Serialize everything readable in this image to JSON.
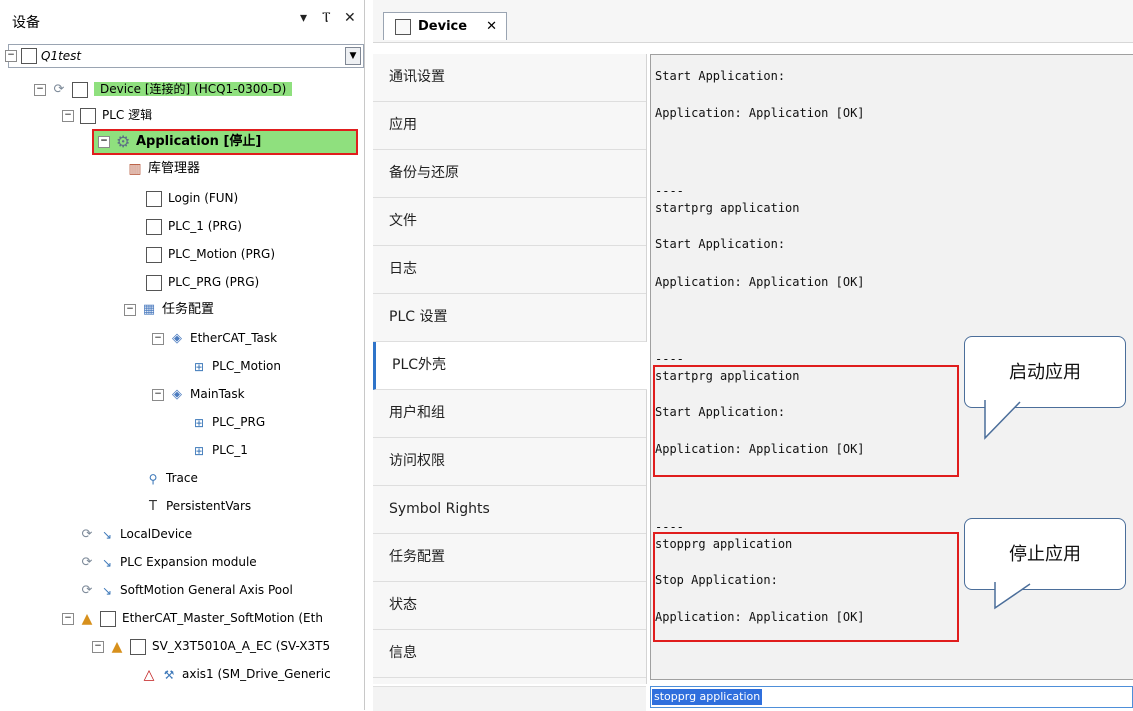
{
  "left_panel": {
    "title": "设备",
    "header_icons": [
      "▾",
      "Ⲧ",
      "✕"
    ],
    "root_project": "Q1test",
    "tree": [
      {
        "key": "device",
        "label": "Device [连接的] (HCQ1-0300-D)"
      },
      {
        "key": "plc_logic",
        "label": "PLC 逻辑"
      },
      {
        "key": "application",
        "label": "Application [停止]"
      },
      {
        "key": "library_manager",
        "label": "库管理器"
      },
      {
        "key": "login",
        "label": "Login (FUN)"
      },
      {
        "key": "plc1",
        "label": "PLC_1 (PRG)"
      },
      {
        "key": "plc_motion",
        "label": "PLC_Motion (PRG)"
      },
      {
        "key": "plc_prg",
        "label": "PLC_PRG (PRG)"
      },
      {
        "key": "task_config",
        "label": "任务配置"
      },
      {
        "key": "ethercat_task",
        "label": "EtherCAT_Task"
      },
      {
        "key": "ethercat_task_plc_motion",
        "label": "PLC_Motion"
      },
      {
        "key": "main_task",
        "label": "MainTask"
      },
      {
        "key": "main_task_plc_prg",
        "label": "PLC_PRG"
      },
      {
        "key": "main_task_plc1",
        "label": "PLC_1"
      },
      {
        "key": "trace",
        "label": "Trace"
      },
      {
        "key": "persistent_vars",
        "label": "PersistentVars"
      },
      {
        "key": "local_device",
        "label": "LocalDevice"
      },
      {
        "key": "plc_expansion",
        "label": "PLC Expansion module"
      },
      {
        "key": "softmotion_pool",
        "label": "SoftMotion General Axis Pool"
      },
      {
        "key": "ethercat_master",
        "label": "EtherCAT_Master_SoftMotion (Eth"
      },
      {
        "key": "sv_x3t",
        "label": "SV_X3T5010A_A_EC (SV-X3T5"
      },
      {
        "key": "axis1",
        "label": "axis1 (SM_Drive_Generic"
      }
    ]
  },
  "editor": {
    "tab_label": "Device",
    "tab_close": "✕",
    "menu": [
      "通讯设置",
      "应用",
      "备份与还原",
      "文件",
      "日志",
      "PLC 设置",
      "PLC外壳",
      "用户和组",
      "访问权限",
      "Symbol Rights",
      "任务配置",
      "状态",
      "信息"
    ],
    "active_menu_index": 6,
    "output_lines": [
      "Start Application:",
      "Application: Application [OK]",
      "----",
      "startprg application",
      "Start Application:",
      "Application: Application [OK]",
      "----",
      "startprg application",
      "Start Application:",
      "Application: Application [OK]",
      "----",
      "stopprg application",
      "Stop Application:",
      "Application: Application [OK]"
    ],
    "command_input_value": "stopprg application"
  },
  "annotations": {
    "start_callout": "启动应用",
    "stop_callout": "停止应用"
  },
  "colors": {
    "highlight_green": "#8fe07e",
    "annotation_red": "#e01d1d",
    "active_tab_blue": "#2f74c9",
    "selection_blue": "#2f6fdd"
  }
}
